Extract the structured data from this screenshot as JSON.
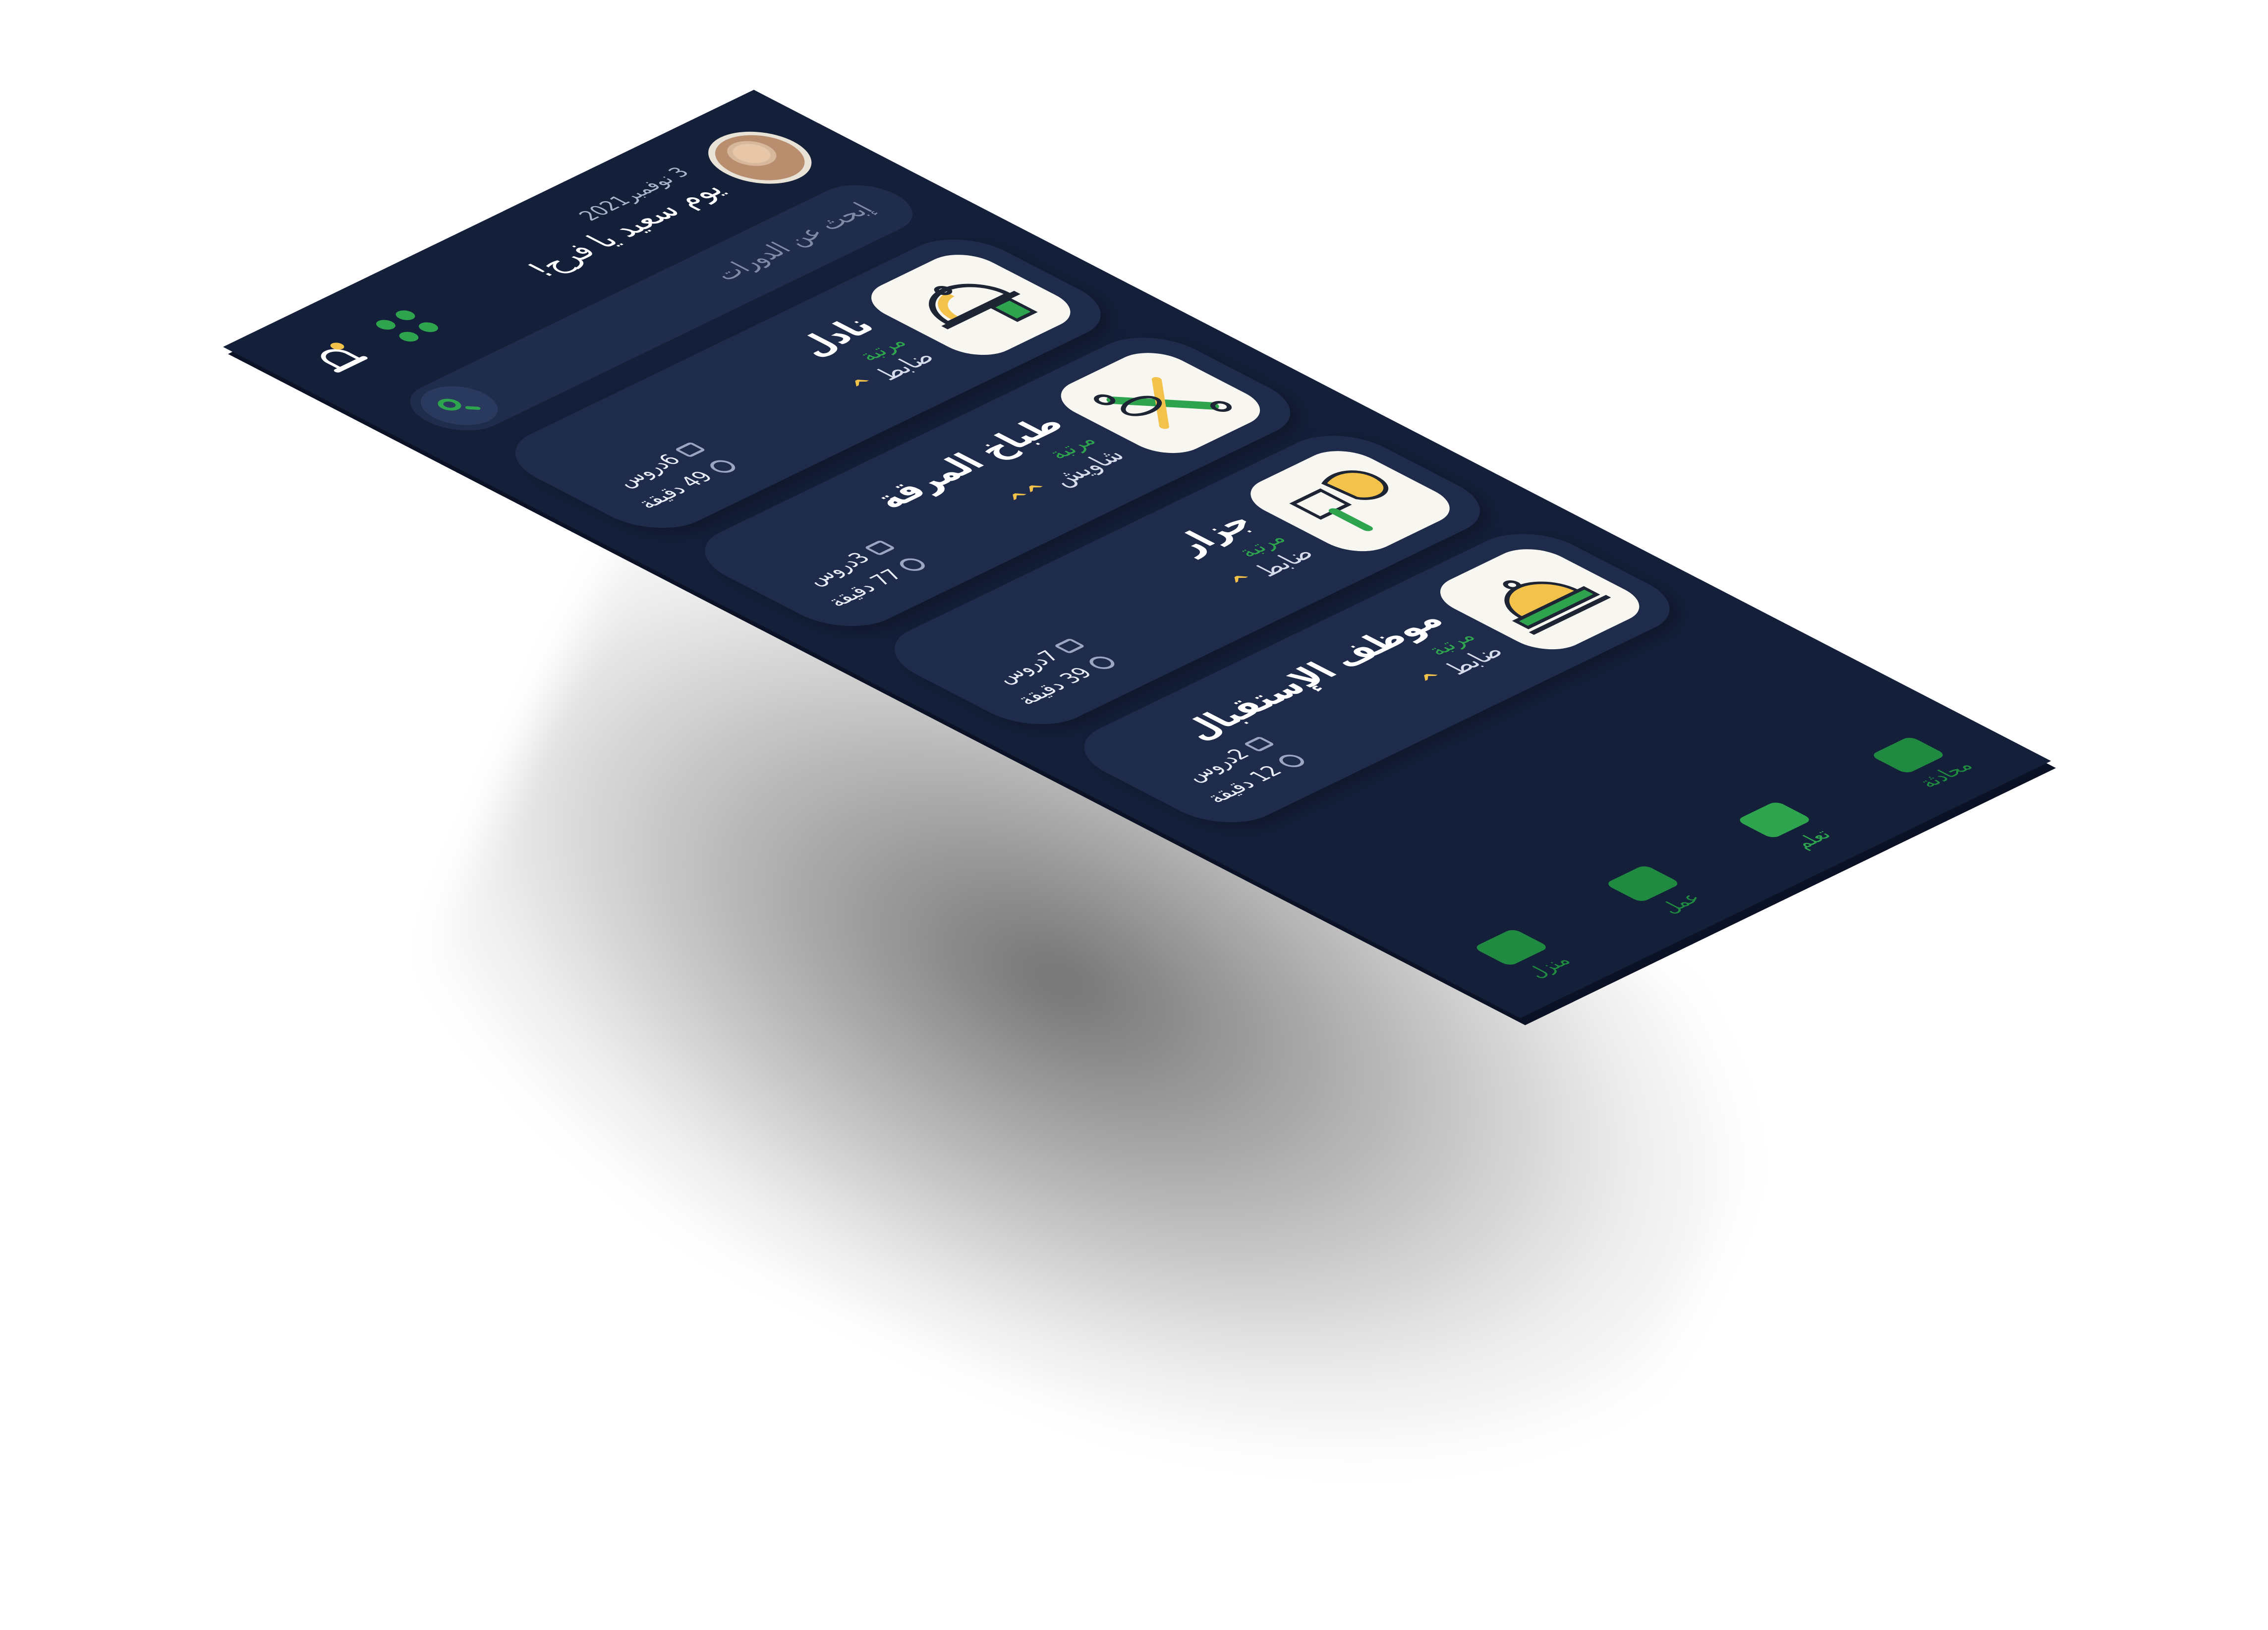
{
  "header": {
    "date": "3 نوفمبر2021",
    "greeting": "يوم سعيد يا فرح!"
  },
  "search": {
    "placeholder": "إبحث عن الدورات"
  },
  "courses": [
    {
      "title": "نادل",
      "rank_label": "مرتبة",
      "rank": "ضابط",
      "chevrons": "^",
      "lessons": "6دروس",
      "minutes": "49 دقيقة",
      "icon": "serving-cloche-icon"
    },
    {
      "title": "طباخ المرقة",
      "rank_label": "مرتبة",
      "rank": "شاويش",
      "chevrons": "^^",
      "lessons": "3دروس",
      "minutes": "77 دقيقة",
      "icon": "whisk-rolling-pin-icon"
    },
    {
      "title": "جزار",
      "rank_label": "مرتبة",
      "rank": "ضابط",
      "chevrons": "^",
      "lessons": "7دروس",
      "minutes": "39 دقيقة",
      "icon": "cleaver-meat-icon"
    },
    {
      "title": "موظف الإستقبال",
      "rank_label": "مرتبة",
      "rank": "ضابط",
      "chevrons": "^",
      "lessons": "2دروس",
      "minutes": "12 دقيقة",
      "icon": "reception-bell-icon"
    }
  ],
  "nav": [
    {
      "label": "محادثة",
      "icon": "chat-icon"
    },
    {
      "label": "تعلم",
      "icon": "certificate-icon"
    },
    {
      "label": "عمل",
      "icon": "briefcase-icon"
    },
    {
      "label": "منزل",
      "icon": "home-icon"
    }
  ],
  "colors": {
    "background": "#141f3a",
    "card": "#1e2b4a",
    "accent": "#2ea44f",
    "rank_chevron": "#f2c24b"
  }
}
